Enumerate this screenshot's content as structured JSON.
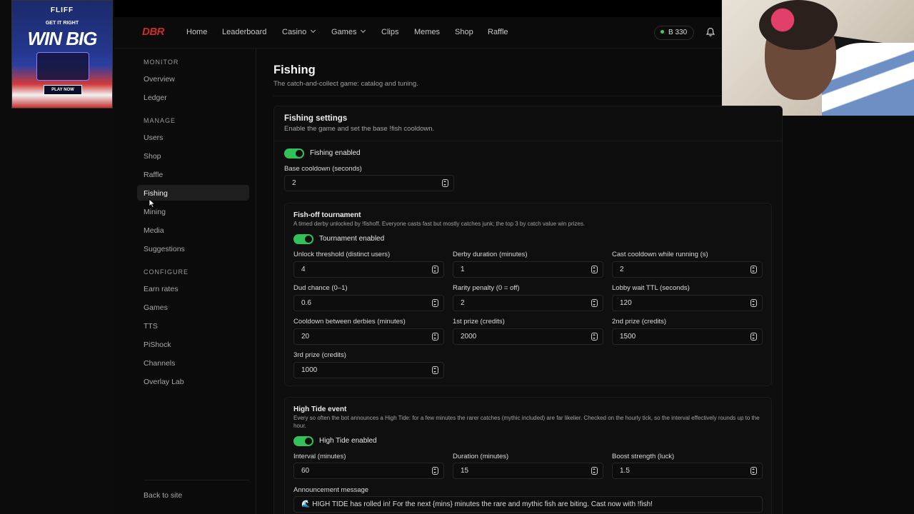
{
  "ad": {
    "brand": "FLIFF",
    "tagline_small": "GET IT RIGHT",
    "tagline_big": "WIN BIG",
    "cta": "PLAY NOW"
  },
  "nav": {
    "logo": "DBR",
    "items": [
      "Home",
      "Leaderboard",
      "Casino",
      "Games",
      "Clips",
      "Memes",
      "Shop",
      "Raffle"
    ],
    "balance": "B 330"
  },
  "sidebar": {
    "monitor_heading": "MONITOR",
    "monitor": [
      "Overview",
      "Ledger"
    ],
    "manage_heading": "MANAGE",
    "manage": [
      "Users",
      "Shop",
      "Raffle",
      "Fishing",
      "Mining",
      "Media",
      "Suggestions"
    ],
    "configure_heading": "CONFIGURE",
    "configure": [
      "Earn rates",
      "Games",
      "TTS",
      "PiShock",
      "Channels",
      "Overlay Lab"
    ],
    "back": "Back to site",
    "active": "Fishing"
  },
  "page": {
    "title": "Fishing",
    "subtitle": "The catch-and-collect game: catalog and tuning."
  },
  "settings": {
    "title": "Fishing settings",
    "subtitle": "Enable the game and set the base !fish cooldown.",
    "enabled_label": "Fishing enabled",
    "enabled": true,
    "cooldown_label": "Base cooldown (seconds)",
    "cooldown_value": "2"
  },
  "tournament": {
    "title": "Fish-off tournament",
    "subtitle": "A timed derby unlocked by !fishoff. Everyone casts fast but mostly catches junk; the top 3 by catch value win prizes.",
    "enabled_label": "Tournament enabled",
    "enabled": true,
    "fields": {
      "unlock_label": "Unlock threshold (distinct users)",
      "unlock_value": "4",
      "derby_label": "Derby duration (minutes)",
      "derby_value": "1",
      "cast_label": "Cast cooldown while running (s)",
      "cast_value": "2",
      "dud_label": "Dud chance (0–1)",
      "dud_value": "0.6",
      "rarity_label": "Rarity penalty (0 = off)",
      "rarity_value": "2",
      "lobby_label": "Lobby wait TTL (seconds)",
      "lobby_value": "120",
      "between_label": "Cooldown between derbies (minutes)",
      "between_value": "20",
      "prize1_label": "1st prize (credits)",
      "prize1_value": "2000",
      "prize2_label": "2nd prize (credits)",
      "prize2_value": "1500",
      "prize3_label": "3rd prize (credits)",
      "prize3_value": "1000"
    }
  },
  "hightide": {
    "title": "High Tide event",
    "subtitle": "Every so often the bot announces a High Tide: for a few minutes the rarer catches (mythic included) are far likelier. Checked on the hourly tick, so the interval effectively rounds up to the hour.",
    "enabled_label": "High Tide enabled",
    "enabled": true,
    "interval_label": "Interval (minutes)",
    "interval_value": "60",
    "duration_label": "Duration (minutes)",
    "duration_value": "15",
    "boost_label": "Boost strength (luck)",
    "boost_value": "1.5",
    "message_label": "Announcement message",
    "message_value": "🌊 HIGH TIDE has rolled in! For the next {mins} minutes the rare and mythic fish are biting. Cast now with !fish!"
  },
  "colors": {
    "accent_green": "#33c25a",
    "logo_red": "#d02b2b"
  }
}
